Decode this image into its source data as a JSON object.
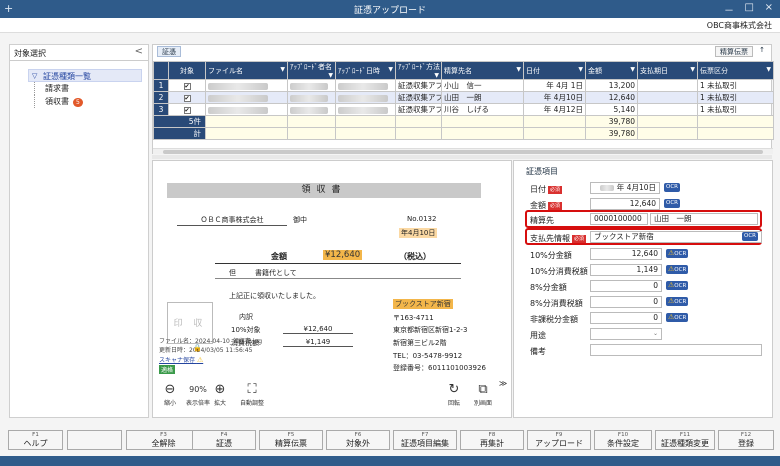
{
  "titlebar": {
    "title": "証憑アップロード",
    "newtab": "+",
    "min": "－",
    "max": "□",
    "close": "×"
  },
  "company": "OBC商事株式会社",
  "sidebar": {
    "header": "対象選択",
    "collapse": "<",
    "root": "証憑種類一覧",
    "items": [
      {
        "label": "請求書"
      },
      {
        "label": "領収書",
        "badge": "5"
      }
    ]
  },
  "grid": {
    "tab": "証憑",
    "settle_button": "精算伝票",
    "pin": "↑",
    "headers": {
      "target": "対象",
      "filename": "ファイル名",
      "uploader": "ｱｯﾌﾟﾛｰﾄﾞ者名",
      "upload_date": "ｱｯﾌﾟﾛｰﾄﾞ日時",
      "upload_method": "ｱｯﾌﾟﾛｰﾄﾞ方法",
      "payee": "精算先名",
      "date": "日付",
      "amount": "金額",
      "pay_date": "支払期日",
      "slip": "伝票区分"
    },
    "rows": [
      {
        "no": "1",
        "method": "証憑収集アプリ",
        "payee": "小山　信一",
        "date": "年  4月  1日",
        "amount": "13,200",
        "slip": "1  未払取引"
      },
      {
        "no": "2",
        "method": "証憑収集アプリ",
        "payee": "山田　一朗",
        "date": "年  4月10日",
        "amount": "12,640",
        "slip": "1  未払取引"
      },
      {
        "no": "3",
        "method": "証憑収集アプリ",
        "payee": "川谷　しげる",
        "date": "年  4月12日",
        "amount": "5,140",
        "slip": "1  未払取引"
      }
    ],
    "count_label": "5件",
    "count_amount": "39,780",
    "total_label": "計",
    "total_amount": "39,780"
  },
  "receipt": {
    "title": "領収書",
    "addressee": "ＯＢＣ商事株式会社",
    "onchu": "御中",
    "number": "No.0132",
    "date": "年4月10日",
    "amount_label": "金額",
    "amount": "¥12,640",
    "tax_incl": "（税込）",
    "tadashi": "但",
    "purpose": "書籍代として",
    "received": "上記正に領収いたしました。",
    "breakdown": "内訳",
    "tax10_label": "10%対象",
    "tax10_amount": "¥12,640",
    "consumption_label": "消費税額",
    "consumption_amount": "¥1,149",
    "stamp": "印 収",
    "shop": "ブックストア新宿",
    "postal": "〒163-4711",
    "address1": "東京都新宿区新宿1-2-3",
    "address2": "新宿第三ビル2階",
    "tel": "TEL：03-5478-9912",
    "reg": "登録番号：6011101003926"
  },
  "fileinfo": {
    "filename": "ファイル名：2024-04-10_領収書.jpg",
    "updated": "更新日時：2024/03/05 11:56:45",
    "scanner": "スキャナ保存",
    "status": "適格"
  },
  "preview_tools": {
    "shrink": "縮小",
    "zoom": "90%",
    "zoom_label": "表示倍率",
    "enlarge": "拡大",
    "auto": "自動調整",
    "rotate": "回転",
    "other_window": "別画面",
    "more": "≫"
  },
  "form": {
    "header": "証憑項目",
    "req": "必須",
    "ocr": "OCR",
    "date_label": "日付",
    "date_value": "年  4月10日",
    "amount_label": "金額",
    "amount_value": "12,640",
    "settle_label": "精算先",
    "settle_code": "0000100000",
    "settle_name": "山田　一朗",
    "payee_label": "支払先情報",
    "payee_value": "ブックストア新宿",
    "r10_label": "10%分金額",
    "r10_value": "12,640",
    "r10tax_label": "10%分消費税額",
    "r10tax_value": "1,149",
    "r8_label": "8%分金額",
    "r8_value": "0",
    "r8tax_label": "8%分消費税額",
    "r8tax_value": "0",
    "nontax_label": "非課税分金額",
    "nontax_value": "0",
    "use_label": "用途",
    "note_label": "備考"
  },
  "fkeys": [
    {
      "n": "F1",
      "l": "ヘルプ"
    },
    {
      "n": "",
      "l": ""
    },
    {
      "n": "F3",
      "l": "全解除"
    },
    {
      "n": "F4",
      "l": "証憑"
    },
    {
      "n": "F5",
      "l": "精算伝票"
    },
    {
      "n": "F6",
      "l": "対象外"
    },
    {
      "n": "F7",
      "l": "証憑項目編集"
    },
    {
      "n": "F8",
      "l": "再集計"
    },
    {
      "n": "F9",
      "l": "アップロード"
    },
    {
      "n": "F10",
      "l": "条件設定"
    },
    {
      "n": "F11",
      "l": "証憑種類変更"
    },
    {
      "n": "F12",
      "l": "登録"
    }
  ]
}
